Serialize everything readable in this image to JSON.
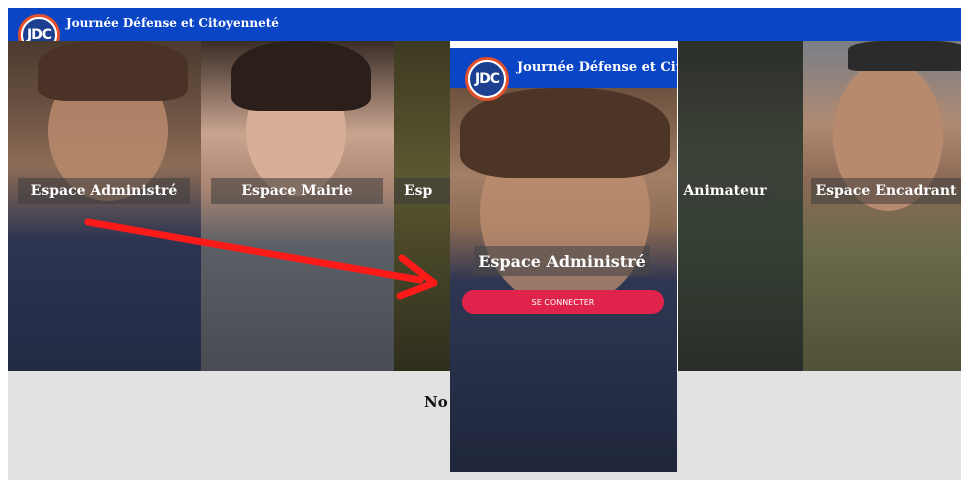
{
  "header": {
    "logo_text": "JDC",
    "title": "Journée Défense et Citoyenneté"
  },
  "spaces": [
    {
      "label": "Espace Administré"
    },
    {
      "label": "Espace Mairie"
    },
    {
      "label": "Esp"
    },
    {
      "label": "Animateur"
    },
    {
      "label": "Espace Encadrant"
    }
  ],
  "bottom": {
    "text": "No"
  },
  "overlay": {
    "logo_text": "JDC",
    "title": "Journée Défense et Cito",
    "space_label": "Espace Administré",
    "button_label": "SE CONNECTER"
  },
  "colors": {
    "header_blue": "#0a45c6",
    "button_red": "#e0234a",
    "arrow_red": "#ff1a1a",
    "bottom_grey": "#e2e2e2"
  }
}
